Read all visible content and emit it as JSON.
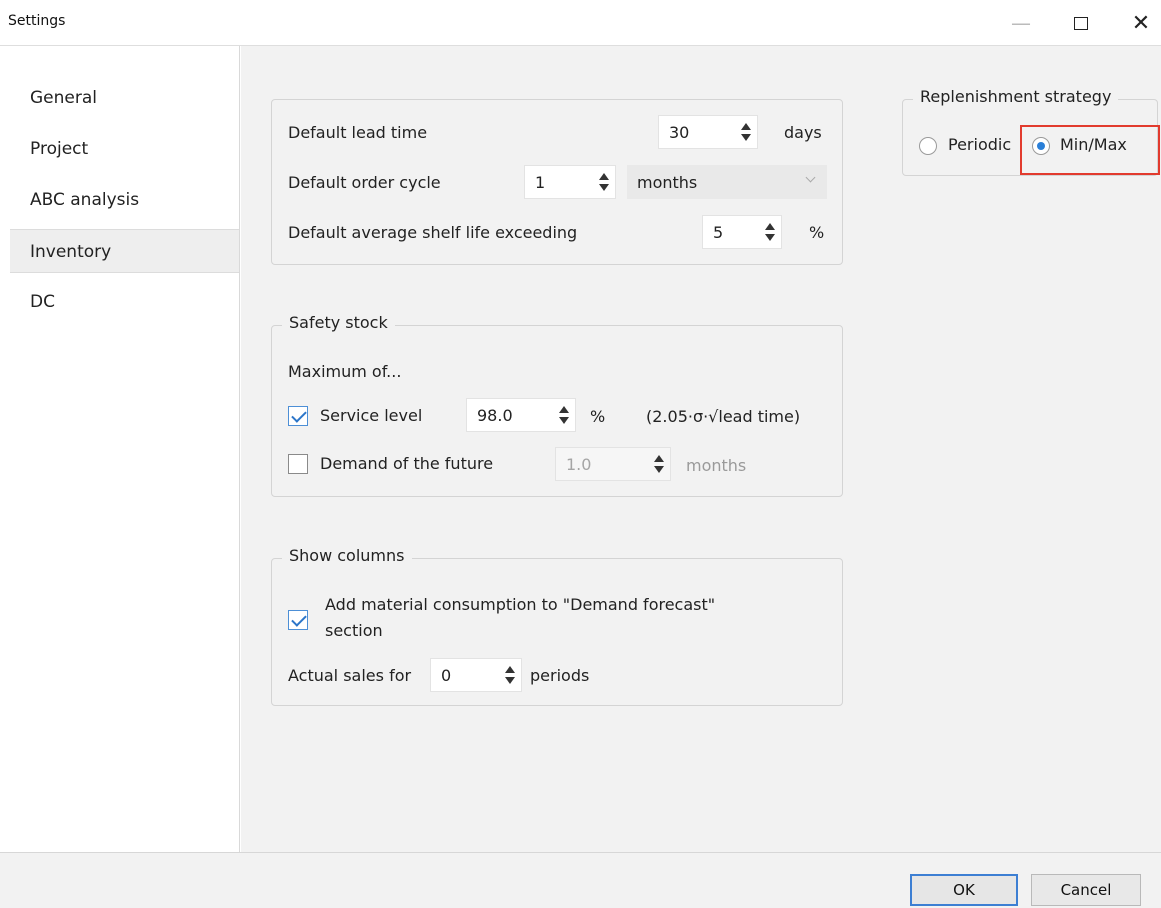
{
  "window": {
    "title": "Settings",
    "minimize_glyph": "—",
    "close_glyph": "✕"
  },
  "sidebar": {
    "items": [
      {
        "label": "General"
      },
      {
        "label": "Project"
      },
      {
        "label": "ABC analysis"
      },
      {
        "label": "Inventory",
        "active": true
      },
      {
        "label": "DC"
      }
    ]
  },
  "defaults": {
    "lead_time": {
      "label": "Default lead time",
      "value": "30",
      "unit": "days"
    },
    "order_cycle": {
      "label": "Default order cycle",
      "value": "1",
      "unit_selected": "months"
    },
    "shelf_life": {
      "label": "Default average shelf life exceeding",
      "value": "5",
      "unit": "%"
    }
  },
  "safety_stock": {
    "title": "Safety stock",
    "maximum_of_label": "Maximum of...",
    "service_level": {
      "label": "Service level",
      "checked": true,
      "value": "98.0",
      "unit": "%",
      "formula": "(2.05·σ·√lead time)"
    },
    "demand_future": {
      "label": "Demand of the future",
      "checked": false,
      "value": "1.0",
      "unit": "months"
    }
  },
  "show_columns": {
    "title": "Show columns",
    "add_material": {
      "label_line1": "Add material consumption to \"Demand forecast\"",
      "label_line2": "section",
      "checked": true
    },
    "actual_sales": {
      "label": "Actual sales for",
      "value": "0",
      "unit": "periods"
    }
  },
  "replenishment": {
    "title": "Replenishment strategy",
    "options": [
      {
        "label": "Periodic",
        "selected": false
      },
      {
        "label": "Min/Max",
        "selected": true
      }
    ]
  },
  "footer": {
    "ok_label": "OK",
    "cancel_label": "Cancel"
  },
  "colors": {
    "accent": "#2a7fd8",
    "highlight": "#e23b2e",
    "content_bg": "#f2f2f2"
  }
}
